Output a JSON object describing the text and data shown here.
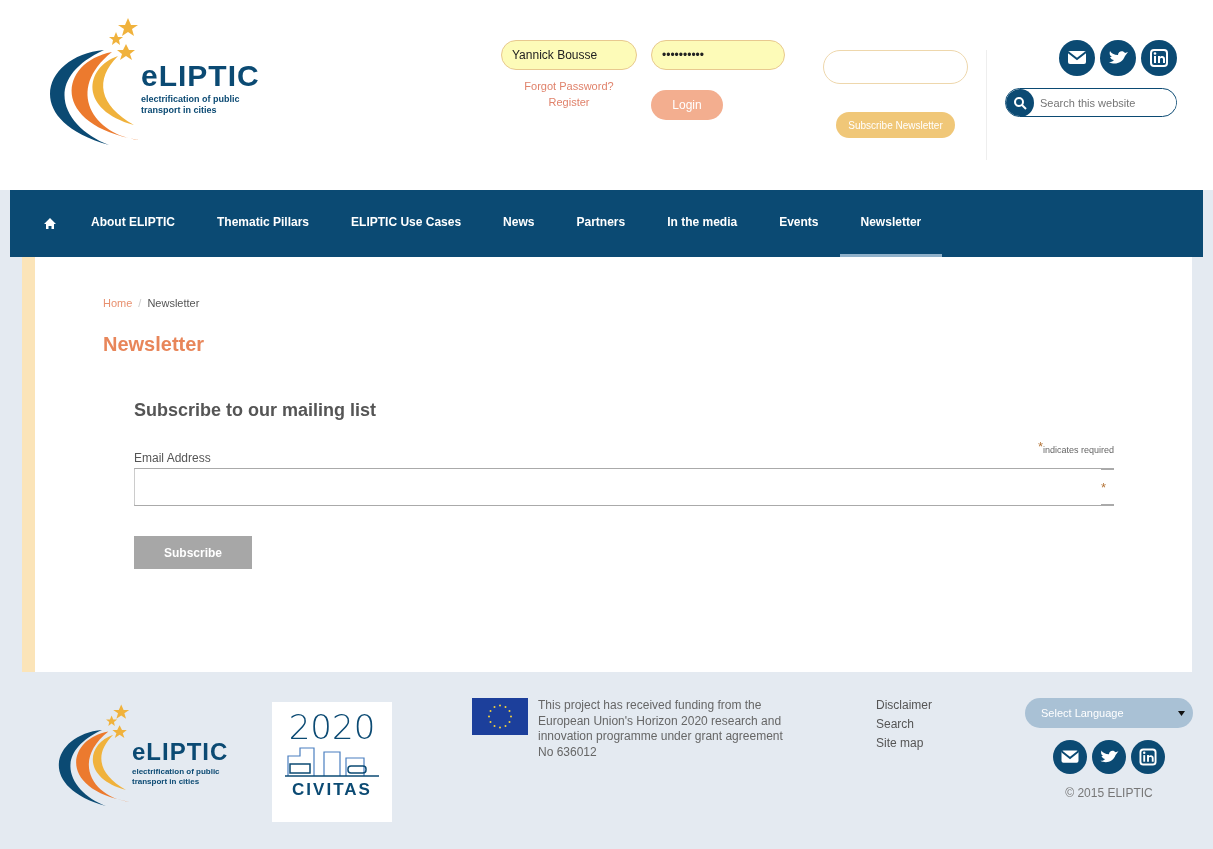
{
  "header": {
    "logo": {
      "wordmark": "eLIPTIC",
      "tagline": "electrification of public transport in cities"
    },
    "login": {
      "username": "Yannick Bousse",
      "password": "••••••••••",
      "forgot": "Forgot Password?",
      "register": "Register",
      "button": "Login"
    },
    "newsletter": {
      "button": "Subscribe Newsletter"
    },
    "search": {
      "placeholder": "Search this website"
    }
  },
  "nav": {
    "items": [
      {
        "label": "About ELIPTIC",
        "selected": false
      },
      {
        "label": "Thematic Pillars",
        "selected": false
      },
      {
        "label": "ELIPTIC Use Cases",
        "selected": false
      },
      {
        "label": "News",
        "selected": false
      },
      {
        "label": "Partners",
        "selected": false
      },
      {
        "label": "In the media",
        "selected": false
      },
      {
        "label": "Events",
        "selected": false
      },
      {
        "label": "Newsletter",
        "selected": true
      }
    ]
  },
  "breadcrumb": [
    "Home",
    "Newsletter"
  ],
  "breadcrumb_separator": "/",
  "title": "Newsletter",
  "form": {
    "heading": "Subscribe to our mailing list",
    "required_mark": "*",
    "required_note": "indicates required",
    "field_label": "Email Address",
    "field_mark": "*",
    "button": "Subscribe"
  },
  "footer": {
    "logo": {
      "wordmark": "eLIPTIC",
      "tagline": "electrification of public transport in cities"
    },
    "civitas": {
      "numeral": "2020",
      "name": "CIVITAS"
    },
    "funding": "This project has received funding from the European Union's Horizon 2020 research and innovation programme under grant agreement No 636012",
    "links": [
      "Disclaimer",
      "Search",
      "Site map"
    ],
    "language": "Select Language",
    "copyright": "© 2015 ELIPTIC"
  }
}
